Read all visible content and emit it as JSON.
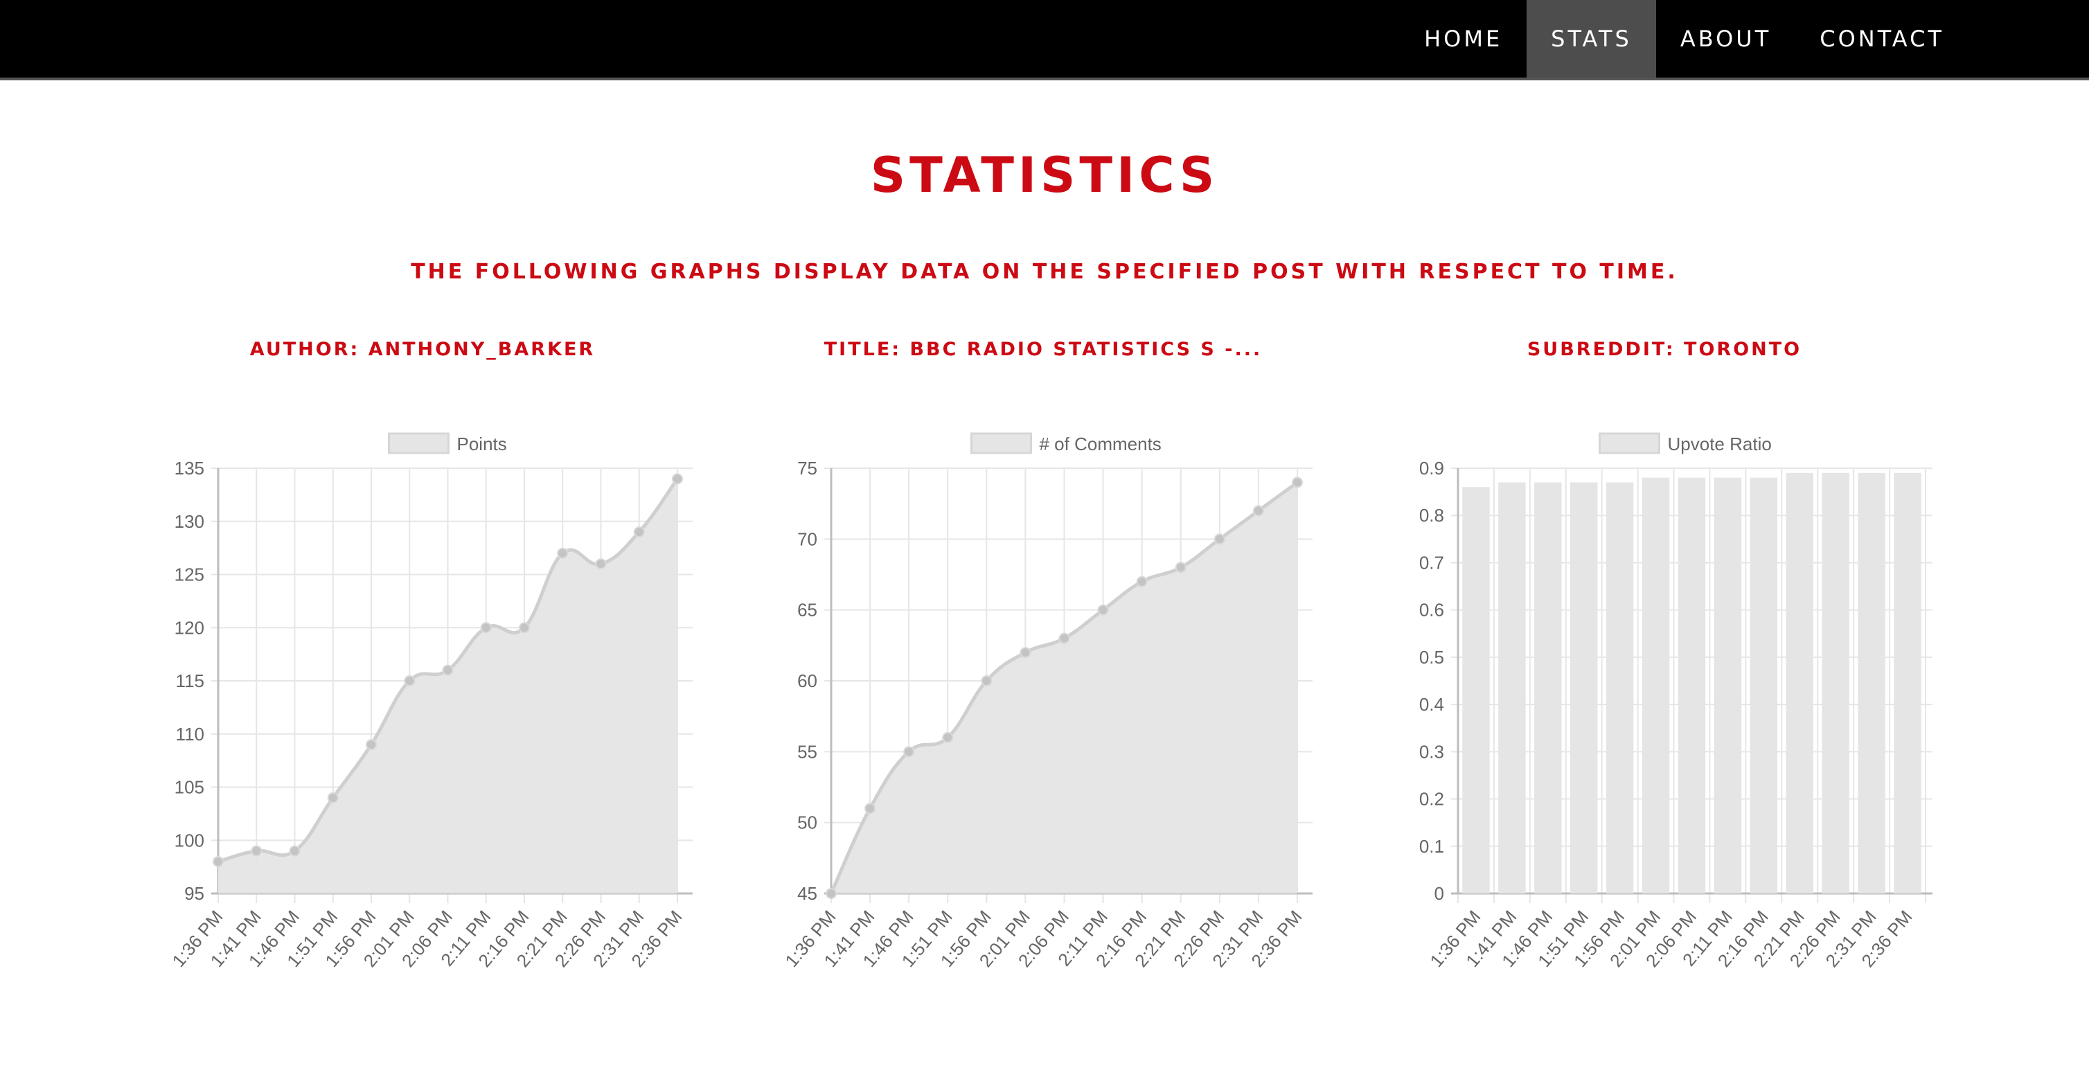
{
  "nav": {
    "items": [
      {
        "label": "HOME",
        "active": false
      },
      {
        "label": "STATS",
        "active": true
      },
      {
        "label": "ABOUT",
        "active": false
      },
      {
        "label": "CONTACT",
        "active": false
      }
    ]
  },
  "page": {
    "title": "STATISTICS",
    "subtitle": "THE FOLLOWING GRAPHS DISPLAY DATA ON THE SPECIFIED POST WITH RESPECT TO TIME."
  },
  "post": {
    "author_label": "AUTHOR: ANTHONY_BARKER",
    "title_label": "TITLE: BBC RADIO STATISTICS S -...",
    "subreddit_label": "SUBREDDIT: TORONTO"
  },
  "colors": {
    "accent": "#cc0a13",
    "nav_background": "#000000",
    "nav_active": "#4d4d4d",
    "chart_fill": "#e5e5e5",
    "chart_line": "#cfcfcf",
    "grid": "#e6e6e6"
  },
  "chart_data": [
    {
      "type": "area",
      "legend": "Points",
      "legend_position": "top",
      "grid": true,
      "categories": [
        "1:36 PM",
        "1:41 PM",
        "1:46 PM",
        "1:51 PM",
        "1:56 PM",
        "2:01 PM",
        "2:06 PM",
        "2:11 PM",
        "2:16 PM",
        "2:21 PM",
        "2:26 PM",
        "2:31 PM",
        "2:36 PM"
      ],
      "values": [
        98,
        99,
        99,
        104,
        109,
        115,
        116,
        120,
        120,
        127,
        126,
        129,
        134
      ],
      "ylim": [
        95,
        135
      ],
      "yticks": [
        95,
        100,
        105,
        110,
        115,
        120,
        125,
        130,
        135
      ]
    },
    {
      "type": "area",
      "legend": "# of Comments",
      "legend_position": "top",
      "grid": true,
      "categories": [
        "1:36 PM",
        "1:41 PM",
        "1:46 PM",
        "1:51 PM",
        "1:56 PM",
        "2:01 PM",
        "2:06 PM",
        "2:11 PM",
        "2:16 PM",
        "2:21 PM",
        "2:26 PM",
        "2:31 PM",
        "2:36 PM"
      ],
      "values": [
        45,
        51,
        55,
        56,
        60,
        62,
        63,
        65,
        67,
        68,
        70,
        72,
        74
      ],
      "ylim": [
        45,
        75
      ],
      "yticks": [
        45,
        50,
        55,
        60,
        65,
        70,
        75
      ]
    },
    {
      "type": "bar",
      "legend": "Upvote Ratio",
      "legend_position": "top",
      "grid": true,
      "categories": [
        "1:36 PM",
        "1:41 PM",
        "1:46 PM",
        "1:51 PM",
        "1:56 PM",
        "2:01 PM",
        "2:06 PM",
        "2:11 PM",
        "2:16 PM",
        "2:21 PM",
        "2:26 PM",
        "2:31 PM",
        "2:36 PM"
      ],
      "values": [
        0.86,
        0.87,
        0.87,
        0.87,
        0.87,
        0.88,
        0.88,
        0.88,
        0.88,
        0.89,
        0.89,
        0.89,
        0.89
      ],
      "ylim": [
        0,
        0.9
      ],
      "yticks": [
        "0",
        "0.1",
        "0.2",
        "0.3",
        "0.4",
        "0.5",
        "0.6",
        "0.7",
        "0.8",
        "0.9"
      ]
    }
  ]
}
